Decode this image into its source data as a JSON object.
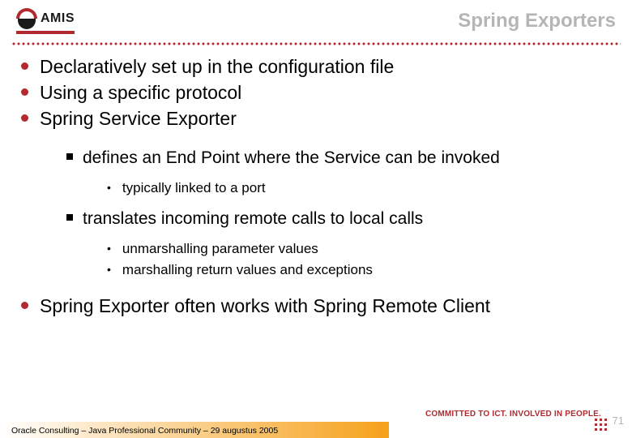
{
  "logo": {
    "text": "AMIS"
  },
  "title": "Spring Exporters",
  "bullets": {
    "l1_0": "Declaratively set up in the configuration file",
    "l1_1": "Using a specific protocol",
    "l1_2": "Spring Service Exporter",
    "l2_0": "defines an End Point where the Service can be invoked",
    "l3_0": "typically linked to a port",
    "l2_1": "translates incoming remote calls to local calls",
    "l3_1": "unmarshalling parameter values",
    "l3_2": "marshalling return values and exceptions",
    "l1_3": "Spring Exporter often works with Spring Remote Client"
  },
  "footer": {
    "text": "Oracle Consulting – Java Professional Community – 29 augustus 2005",
    "tagline": "COMMITTED TO ICT. INVOLVED IN PEOPLE.",
    "page": "71"
  }
}
